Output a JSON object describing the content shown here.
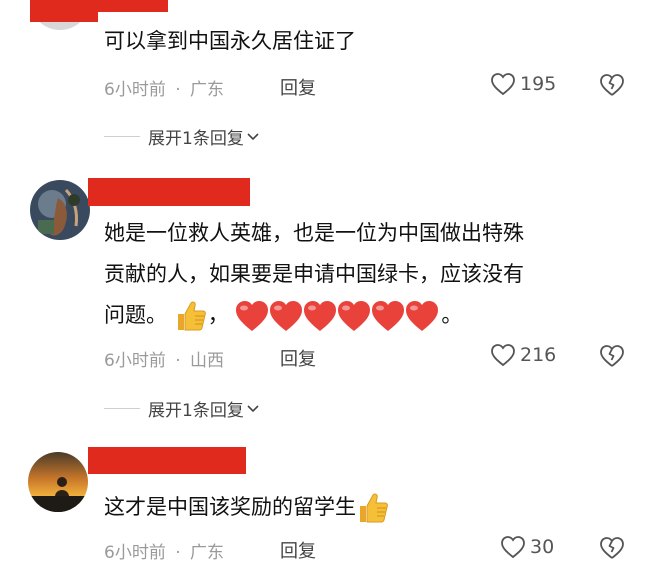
{
  "comments": [
    {
      "text_lines": [
        "可以拿到中国永久居住证了"
      ],
      "time": "6小时前",
      "location": "广东",
      "reply_label": "回复",
      "like_count": "195",
      "expand_label": "展开1条回复"
    },
    {
      "text_lines": [
        "她是一位救人英雄，也是一位为中国做出特殊",
        "贡献的人，如果要是申请中国绿卡，应该没有",
        "问题。"
      ],
      "text_line3_comma": "，",
      "text_line3_end": "。",
      "time": "6小时前",
      "location": "山西",
      "reply_label": "回复",
      "like_count": "216",
      "expand_label": "展开1条回复"
    },
    {
      "text_lines": [
        "这才是中国该奖励的留学生"
      ],
      "time": "6小时前",
      "location": "广东",
      "reply_label": "回复",
      "like_count": "30"
    }
  ],
  "meta_separator": "·",
  "icons": {
    "like": "heart-outline-icon",
    "dislike": "broken-heart-icon",
    "expand": "chevron-down-icon",
    "thumbs_up": "thumbs-up-emoji",
    "red_heart": "red-heart-emoji"
  },
  "colors": {
    "redacted_name": "#e02a1e",
    "red_heart": "#e8423a"
  }
}
